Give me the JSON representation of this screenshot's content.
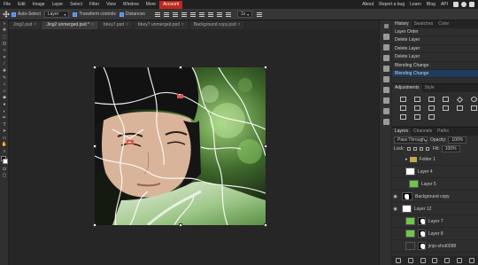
{
  "menubar": {
    "items": [
      "File",
      "Edit",
      "Image",
      "Layer",
      "Select",
      "Filter",
      "View",
      "Window",
      "More",
      "Account"
    ],
    "right_items": [
      "About",
      "Report a bug",
      "Learn",
      "Blog",
      "API"
    ]
  },
  "options": {
    "auto_select_label": "Auto-Select",
    "layer_select_value": "Layer",
    "transform_controls_label": "Transform controls",
    "distances_label": "Distances",
    "zoom_value": "1x"
  },
  "tabs": [
    {
      "label": "Jing2.psd",
      "active": false
    },
    {
      "label": "Jing2 unmerged.psd *",
      "active": true
    },
    {
      "label": "bbey7.psd",
      "active": false
    },
    {
      "label": "bbey7 unmerged.psd",
      "active": false
    },
    {
      "label": "Background copy.psd",
      "active": false
    }
  ],
  "history": {
    "tabs": [
      "History",
      "Swatches",
      "Color"
    ],
    "items": [
      "Layer Order",
      "Delete Layer",
      "Delete Layer",
      "Delete Layer",
      "Blending Change",
      "Blending Change"
    ]
  },
  "adjustments": {
    "tabs": [
      "Adjustments",
      "Style"
    ]
  },
  "layers": {
    "tabs": [
      "Layers",
      "Channels",
      "Paths"
    ],
    "blend_mode": "Pass Through",
    "opacity_label": "Opacity:",
    "opacity_value": "100%",
    "lock_label": "Lock:",
    "fill_label": "Fill:",
    "fill_value": "100%",
    "items": [
      {
        "name": "Folder 1",
        "type": "folder",
        "visible": false,
        "thumb": "",
        "indent": 2
      },
      {
        "name": "Layer 4",
        "type": "layer",
        "visible": false,
        "thumb": "#ffffff",
        "indent": 2
      },
      {
        "name": "Layer 5",
        "type": "layer",
        "visible": false,
        "thumb": "#6fc74a",
        "indent": 3
      },
      {
        "name": "Background copy",
        "type": "mask",
        "visible": true,
        "thumb": "",
        "indent": 1
      },
      {
        "name": "Layer 12",
        "type": "layer",
        "visible": true,
        "thumb": "#ffffff",
        "indent": 1
      },
      {
        "name": "Layer 7",
        "type": "masked",
        "visible": false,
        "thumb": "#6fc74a",
        "indent": 2
      },
      {
        "name": "Layer 8",
        "type": "masked",
        "visible": false,
        "thumb": "#6fc74a",
        "indent": 2
      },
      {
        "name": "jinjo-shot0288",
        "type": "masked",
        "visible": false,
        "thumb": "#2d2d2d",
        "indent": 2
      }
    ]
  },
  "colors": {
    "accent": "#c1271b",
    "selection": "#1f3c5e",
    "checkbox": "#4a8fe8"
  }
}
